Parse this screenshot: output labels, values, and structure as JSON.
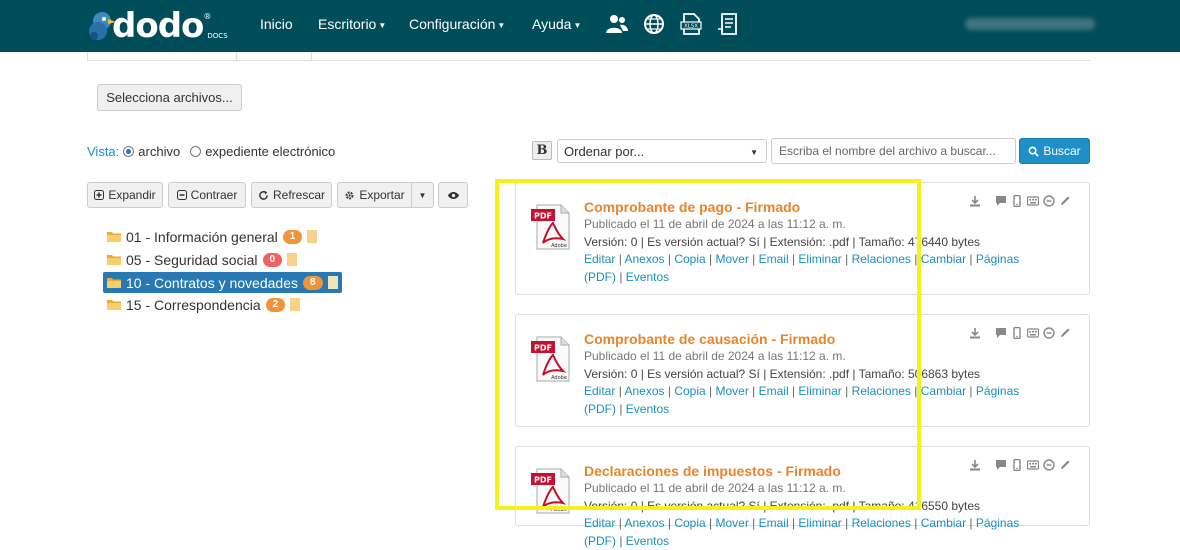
{
  "navbar": {
    "logo_text": "dodo",
    "logo_reg": "®",
    "logo_sub": "DOCS",
    "items": [
      {
        "label": "Inicio"
      },
      {
        "label": "Escritorio"
      },
      {
        "label": "Configuración"
      },
      {
        "label": "Ayuda"
      }
    ],
    "icons": [
      "users-icon",
      "globe-icon",
      "xlsx-file-icon",
      "report-file-icon"
    ]
  },
  "upload": {
    "label": "Selecciona archivos..."
  },
  "vista": {
    "label": "Vista:",
    "options": [
      {
        "label": "archivo",
        "checked": true
      },
      {
        "label": "expediente electrónico",
        "checked": false
      }
    ]
  },
  "tree_toolbar": {
    "expand": "Expandir",
    "collapse": "Contraer",
    "refresh": "Refrescar",
    "export": "Exportar"
  },
  "tree": [
    {
      "label": "01 - Información general",
      "count": "1",
      "selected": false
    },
    {
      "label": "05 - Seguridad social",
      "count": "0",
      "selected": false
    },
    {
      "label": "10 - Contratos y novedades",
      "count": "8",
      "selected": true
    },
    {
      "label": "15 - Correspondencia",
      "count": "2",
      "selected": false
    }
  ],
  "search": {
    "bold_toggle": "B",
    "sort_placeholder": "Ordenar por...",
    "input_placeholder": "Escriba el nombre del archivo a buscar...",
    "button": "Buscar"
  },
  "files": [
    {
      "title": "Comprobante de pago - Firmado",
      "published": "Publicado el 11 de abril de 2024 a las 11:12 a. m.",
      "meta": "Versión: 0 | Es versión actual? Sí | Extensión: .pdf | Tamaño: 476440 bytes"
    },
    {
      "title": "Comprobante de causación - Firmado",
      "published": "Publicado el 11 de abril de 2024 a las 11:12 a. m.",
      "meta": "Versión: 0 | Es versión actual? Sí | Extensión: .pdf | Tamaño: 506863 bytes"
    },
    {
      "title": "Declaraciones de impuestos - Firmado",
      "published": "Publicado el 11 de abril de 2024 a las 11:12 a. m.",
      "meta": "Versión: 0 | Es versión actual? Sí | Extensión: .pdf | Tamaño: 416550 bytes"
    }
  ],
  "file_actions": [
    "Editar",
    "Anexos",
    "Copia",
    "Mover",
    "Email",
    "Eliminar",
    "Relaciones",
    "Cambiar",
    "Páginas (PDF)",
    "Eventos"
  ],
  "pdf_icon": {
    "label": "PDF",
    "brand": "Adobe"
  },
  "colors": {
    "navbar": "#004d5a",
    "accent": "#e8842a",
    "link": "#1a8fbf",
    "selected": "#2878b4",
    "highlight": "#f7f01a"
  }
}
